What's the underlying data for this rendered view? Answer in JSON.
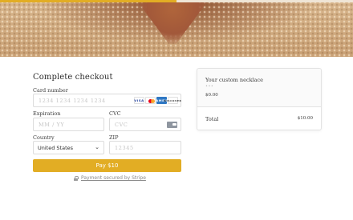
{
  "progress": {
    "fraction": 0.5,
    "color": "#e2ad24"
  },
  "checkout": {
    "title": "Complete checkout",
    "card_number": {
      "label": "Card number",
      "placeholder": "1234 1234 1234 1234",
      "brands": [
        "VISA",
        "Mastercard",
        "AMEX",
        "DISCOVER"
      ]
    },
    "expiration": {
      "label": "Expiration",
      "placeholder": "MM / YY"
    },
    "cvc": {
      "label": "CVC",
      "placeholder": "CVC"
    },
    "country": {
      "label": "Country",
      "value": "United States"
    },
    "zip": {
      "label": "ZIP",
      "placeholder": "12345"
    },
    "pay_button": "Pay $10",
    "secured_text": "Payment secured by Stripe",
    "accent_color": "#e2ad24"
  },
  "summary": {
    "product_name": "Your custom necklace",
    "product_dots": "•••",
    "product_price": "$0.00",
    "total_label": "Total",
    "total_value": "$10.00"
  }
}
